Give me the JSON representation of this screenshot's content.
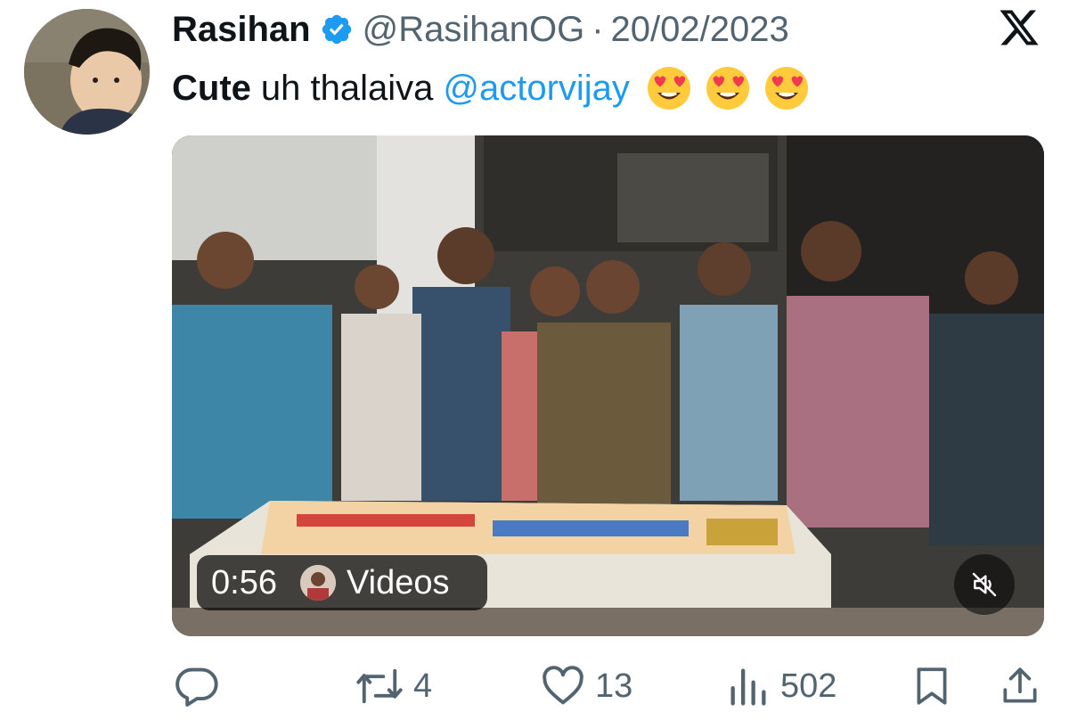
{
  "author": {
    "display_name": "Rasihan",
    "handle": "@RasihanOG",
    "separator": "·",
    "date": "20/02/2023",
    "verified": true
  },
  "tweet": {
    "bold_text": "Cute",
    "text": "uh thalaiva",
    "mention": "@actorvijay",
    "emojis": [
      "heart-eyes",
      "heart-eyes",
      "heart-eyes"
    ]
  },
  "media": {
    "duration": "0:56",
    "channel_label": "Videos",
    "muted": true
  },
  "actions": {
    "reply_count": "",
    "retweet_count": "4",
    "like_count": "13",
    "view_count": "502"
  },
  "colors": {
    "accent": "#1d9bf0",
    "text_primary": "#0f1419",
    "text_secondary": "#536471"
  },
  "icons": [
    "x-logo-icon",
    "verified-badge-icon",
    "reply-icon",
    "retweet-icon",
    "like-icon",
    "views-icon",
    "bookmark-icon",
    "share-icon",
    "mute-icon"
  ]
}
